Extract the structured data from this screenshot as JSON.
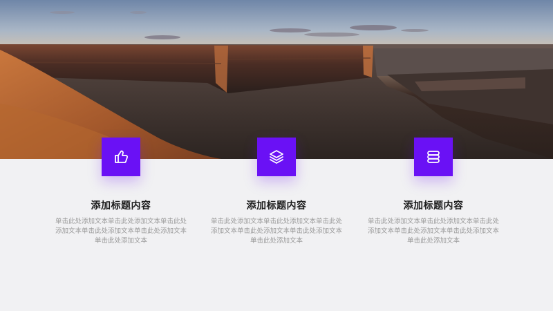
{
  "hero": {
    "image_name": "canyon-landscape-photo"
  },
  "accent_color": "#6a11f5",
  "features": [
    {
      "icon": "thumbs-up-icon",
      "title": "添加标题内容",
      "description": "单击此处添加文本单击此处添加文本单击此处添加文本单击此处添加文本单击此处添加文本单击此处添加文本"
    },
    {
      "icon": "layers-icon",
      "title": "添加标题内容",
      "description": "单击此处添加文本单击此处添加文本单击此处添加文本单击此处添加文本单击此处添加文本单击此处添加文本"
    },
    {
      "icon": "coin-stack-icon",
      "title": "添加标题内容",
      "description": "单击此处添加文本单击此处添加文本单击此处添加文本单击此处添加文本单击此处添加文本单击此处添加文本"
    }
  ]
}
